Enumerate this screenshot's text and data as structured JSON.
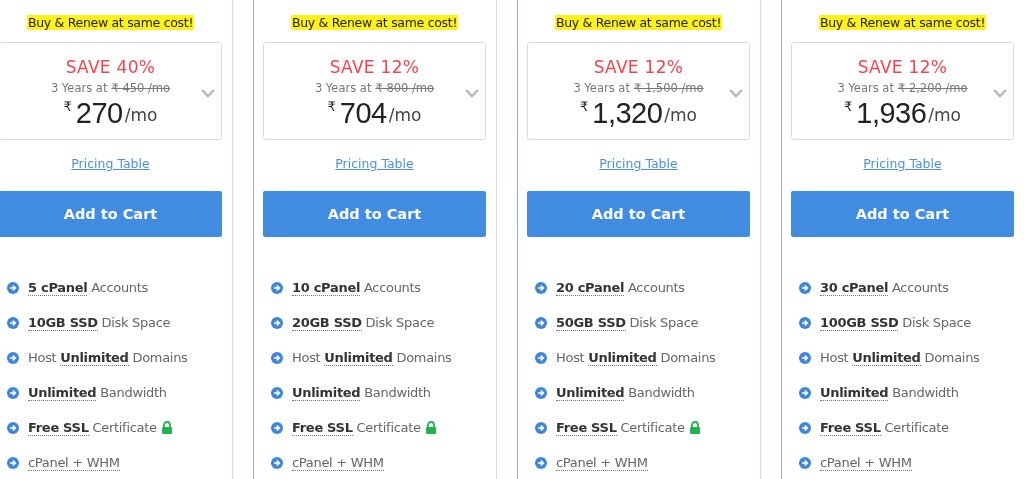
{
  "plans": [
    {
      "banner": "Buy & Renew at same cost!",
      "save": "SAVE 40%",
      "term": "3 Years at",
      "old_price": "₹ 450 /mo",
      "currency": "₹",
      "price": "270",
      "per": "/mo",
      "link": "Pricing Table",
      "button": "Add to Cart",
      "features": [
        {
          "text": "**5 cPanel** Accounts",
          "kind": "highlight"
        },
        {
          "text": "**10GB SSD** Disk Space",
          "kind": "highlight"
        },
        {
          "text": "Host **Unlimited** Domains",
          "kind": "highlight"
        },
        {
          "text": "**Unlimited** Bandwidth",
          "kind": "highlight"
        },
        {
          "text": "**Free SSL** Certificate",
          "kind": "secure"
        },
        {
          "text": "cPanel + WHM",
          "kind": "term"
        }
      ]
    },
    {
      "banner": "Buy & Renew at same cost!",
      "save": "SAVE 12%",
      "term": "3 Years at",
      "old_price": "₹ 800 /mo",
      "currency": "₹",
      "price": "704",
      "per": "/mo",
      "link": "Pricing Table",
      "button": "Add to Cart",
      "features": [
        {
          "text": "**10 cPanel** Accounts",
          "kind": "highlight"
        },
        {
          "text": "**20GB SSD** Disk Space",
          "kind": "highlight"
        },
        {
          "text": "Host **Unlimited** Domains",
          "kind": "highlight"
        },
        {
          "text": "**Unlimited** Bandwidth",
          "kind": "highlight"
        },
        {
          "text": "**Free SSL** Certificate",
          "kind": "secure"
        },
        {
          "text": "cPanel + WHM",
          "kind": "term"
        }
      ]
    },
    {
      "banner": "Buy & Renew at same cost!",
      "save": "SAVE 12%",
      "term": "3 Years at",
      "old_price": "₹ 1,500 /mo",
      "currency": "₹",
      "price": "1,320",
      "per": "/mo",
      "link": "Pricing Table",
      "button": "Add to Cart",
      "features": [
        {
          "text": "**20 cPanel** Accounts",
          "kind": "highlight"
        },
        {
          "text": "**50GB SSD** Disk Space",
          "kind": "highlight"
        },
        {
          "text": "Host **Unlimited** Domains",
          "kind": "highlight"
        },
        {
          "text": "**Unlimited** Bandwidth",
          "kind": "highlight"
        },
        {
          "text": "**Free SSL** Certificate",
          "kind": "secure"
        },
        {
          "text": "cPanel + WHM",
          "kind": "term"
        }
      ]
    },
    {
      "banner": "Buy & Renew at same cost!",
      "save": "SAVE 12%",
      "term": "3 Years at",
      "old_price": "₹ 2,200 /mo",
      "currency": "₹",
      "price": "1,936",
      "per": "/mo",
      "link": "Pricing Table",
      "button": "Add to Cart",
      "features": [
        {
          "text": "**30 cPanel** Accounts",
          "kind": "highlight"
        },
        {
          "text": "**100GB SSD** Disk Space",
          "kind": "highlight"
        },
        {
          "text": "Host **Unlimited** Domains",
          "kind": "highlight"
        },
        {
          "text": "**Unlimited** Bandwidth",
          "kind": "highlight"
        },
        {
          "text": "**Free SSL** Certificate",
          "kind": "highlight"
        },
        {
          "text": "cPanel + WHM",
          "kind": "term"
        }
      ]
    }
  ]
}
